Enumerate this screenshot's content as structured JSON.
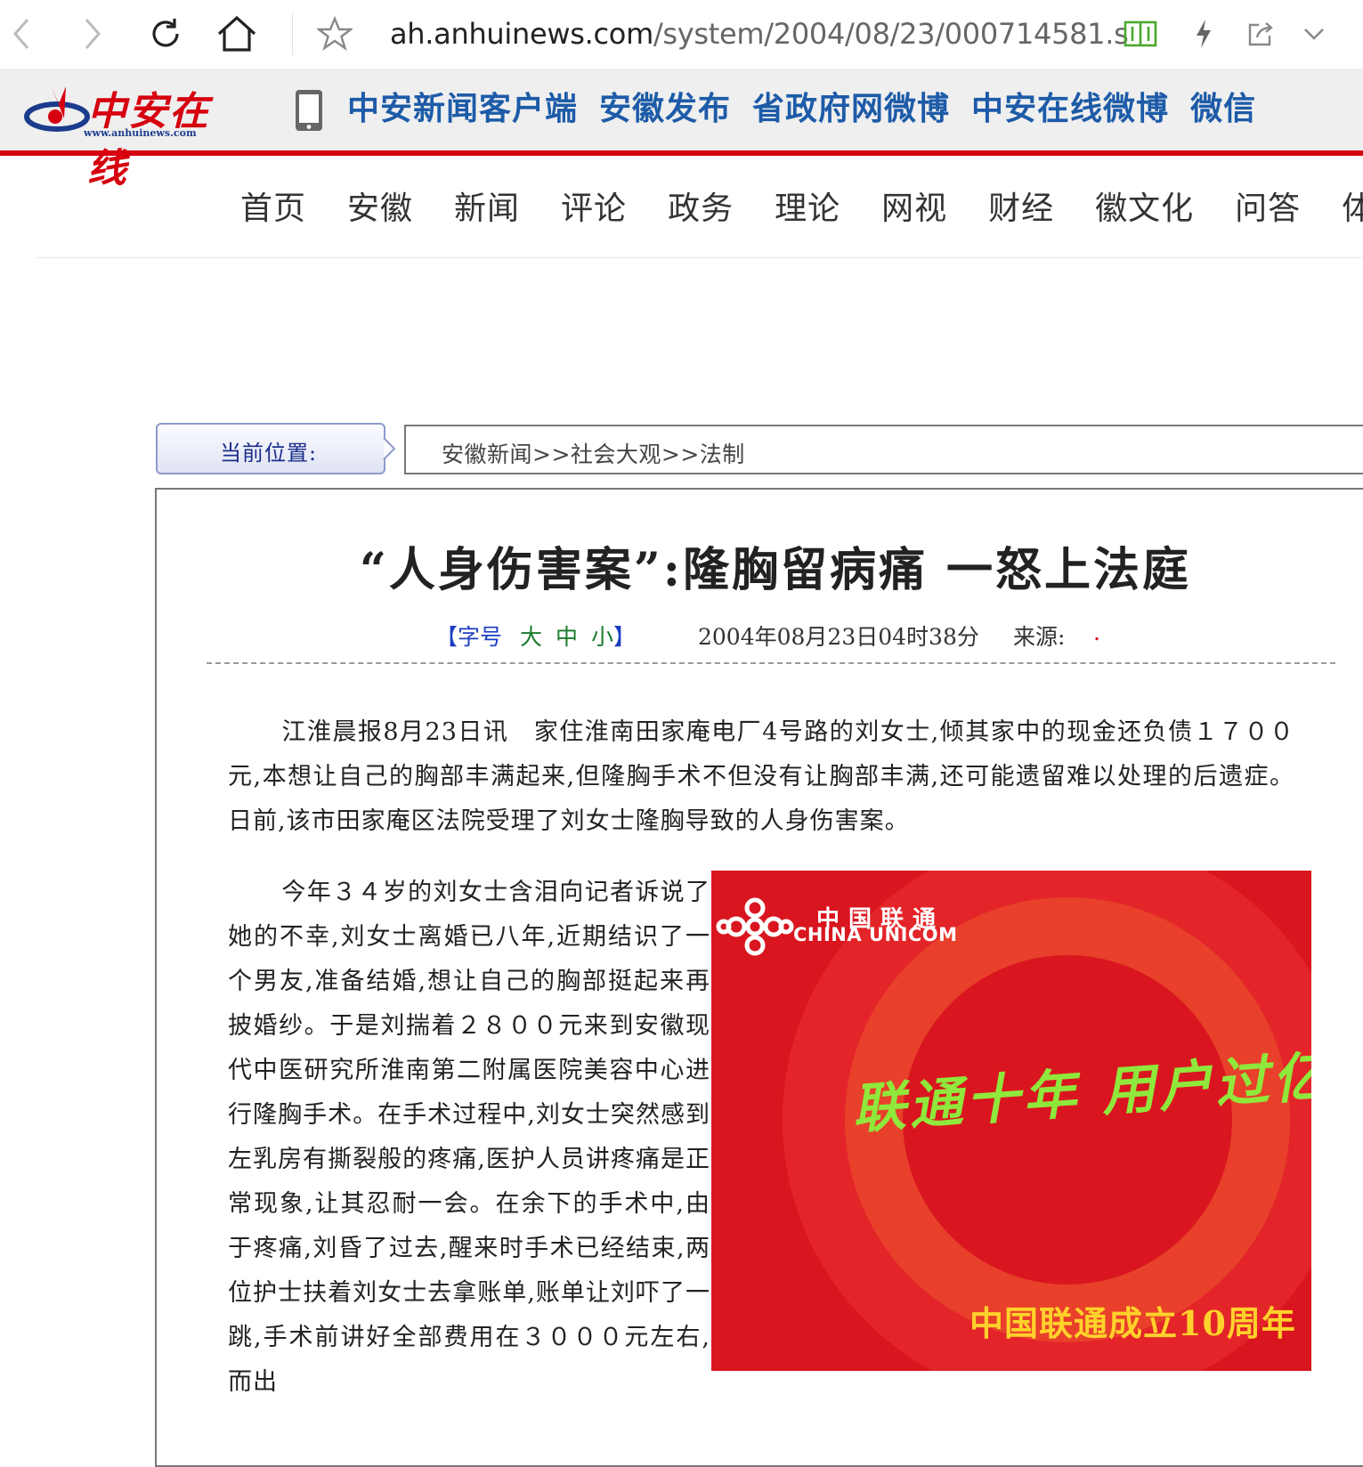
{
  "browser": {
    "url_domain": "ah.anhuinews.com",
    "url_path": "/system/2004/08/23/000714581.s"
  },
  "header": {
    "logo_text": "中安在线",
    "logo_url": "www.anhuinews.com",
    "links": [
      "中安新闻客户端",
      "安徽发布",
      "省政府网微博",
      "中安在线微博",
      "微信"
    ]
  },
  "nav": {
    "items": [
      "首页",
      "安徽",
      "新闻",
      "评论",
      "政务",
      "理论",
      "网视",
      "财经",
      "徽文化",
      "问答",
      "体育"
    ]
  },
  "breadcrumb": {
    "label": "当前位置:",
    "path": "安徽新闻>>社会大观>>法制"
  },
  "article": {
    "title": "“人身伤害案”:隆胸留病痛 一怒上法庭",
    "font_size_open": "【",
    "font_size_label": "字号",
    "font_size_large": "大",
    "font_size_medium": "中",
    "font_size_small": "小",
    "font_size_close": "】",
    "date": "2004年08月23日04时38分",
    "source_label": "来源:",
    "source_value": ".",
    "paragraph1": "江淮晨报8月23日讯　家住淮南田家庵电厂4号路的刘女士,倾其家中的现金还负债１７００元,本想让自己的胸部丰满起来,但隆胸手术不但没有让胸部丰满,还可能遗留难以处理的后遗症。日前,该市田家庵区法院受理了刘女士隆胸导致的人身伤害案。",
    "paragraph2": "今年３４岁的刘女士含泪向记者诉说了她的不幸,刘女士离婚已八年,近期结识了一个男友,准备结婚,想让自己的胸部挺起来再披婚纱。于是刘揣着２８００元来到安徽现代中医研究所淮南第二附属医院美容中心进行隆胸手术。在手术过程中,刘女士突然感到左乳房有撕裂般的疼痛,医护人员讲疼痛是正常现象,让其忍耐一会。在余下的手术中,由于疼痛,刘昏了过去,醒来时手术已经结束,两位护士扶着刘女士去拿账单,账单让刘吓了一跳,手术前讲好全部费用在３０００元左右,而出"
  },
  "ad": {
    "brand_cn": "中国联通",
    "brand_en": "CHINA UNICOM",
    "slogan": "联通十年 用户过亿",
    "anniversary": "中国联通成立10周年"
  },
  "colors": {
    "brand_red": "#d6000f",
    "link_blue": "#1d5ba8",
    "font_size_green": "#1a7b2c",
    "ad_red": "#d9161f",
    "slogan_green": "#8fe83b",
    "anniv_yellow": "#ffd22b"
  },
  "icons": [
    "back-icon",
    "forward-icon",
    "reload-icon",
    "home-icon",
    "star-icon",
    "reader-icon",
    "lightning-icon",
    "share-icon",
    "chevron-down-icon",
    "phone-icon",
    "unicom-knot-icon"
  ]
}
